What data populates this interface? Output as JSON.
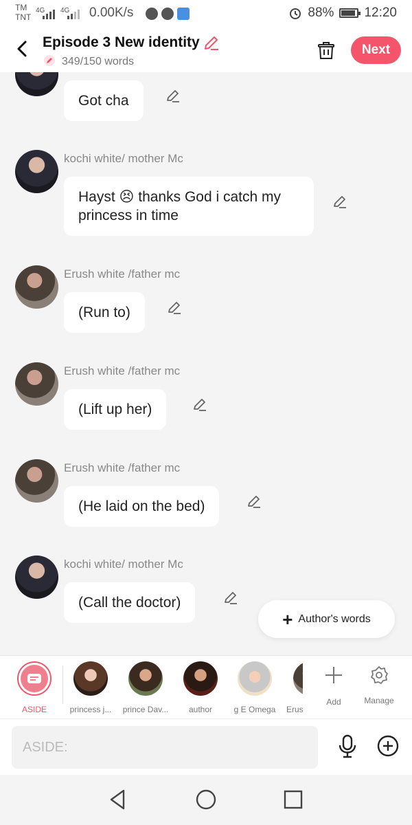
{
  "status": {
    "carrier1": "TM",
    "carrier2": "TNT",
    "net1": "4G",
    "net2": "4G",
    "speed": "0.00K/s",
    "battery": "88%",
    "time": "12:20"
  },
  "header": {
    "title": "Episode 3 New identity",
    "word_count": "349/150 words",
    "next_label": "Next"
  },
  "messages": [
    {
      "name": "",
      "text": "Got cha",
      "avatar": "kochi"
    },
    {
      "name": "kochi white/ mother Mc",
      "text": "Hayst 😣 thanks God i catch my princess in time",
      "avatar": "kochi"
    },
    {
      "name": "Erush white /father mc",
      "text": "(Run to)",
      "avatar": "erush"
    },
    {
      "name": "Erush white /father mc",
      "text": "(Lift up her)",
      "avatar": "erush"
    },
    {
      "name": "Erush white /father mc",
      "text": "(He laid on the bed)",
      "avatar": "erush"
    },
    {
      "name": "kochi white/ mother Mc",
      "text": "(Call the doctor)",
      "avatar": "kochi"
    }
  ],
  "floating": {
    "label": "Author's words"
  },
  "roles": [
    {
      "label": "ASIDE",
      "active": true
    },
    {
      "label": "princess j..."
    },
    {
      "label": "prince Dav..."
    },
    {
      "label": "author"
    },
    {
      "label": "g E Omega"
    },
    {
      "label": "Erusl"
    }
  ],
  "tools": {
    "add_label": "Add",
    "manage_label": "Manage"
  },
  "input": {
    "placeholder": "ASIDE:"
  },
  "colors": {
    "accent": "#f4556b",
    "background": "#f4f4f4"
  }
}
